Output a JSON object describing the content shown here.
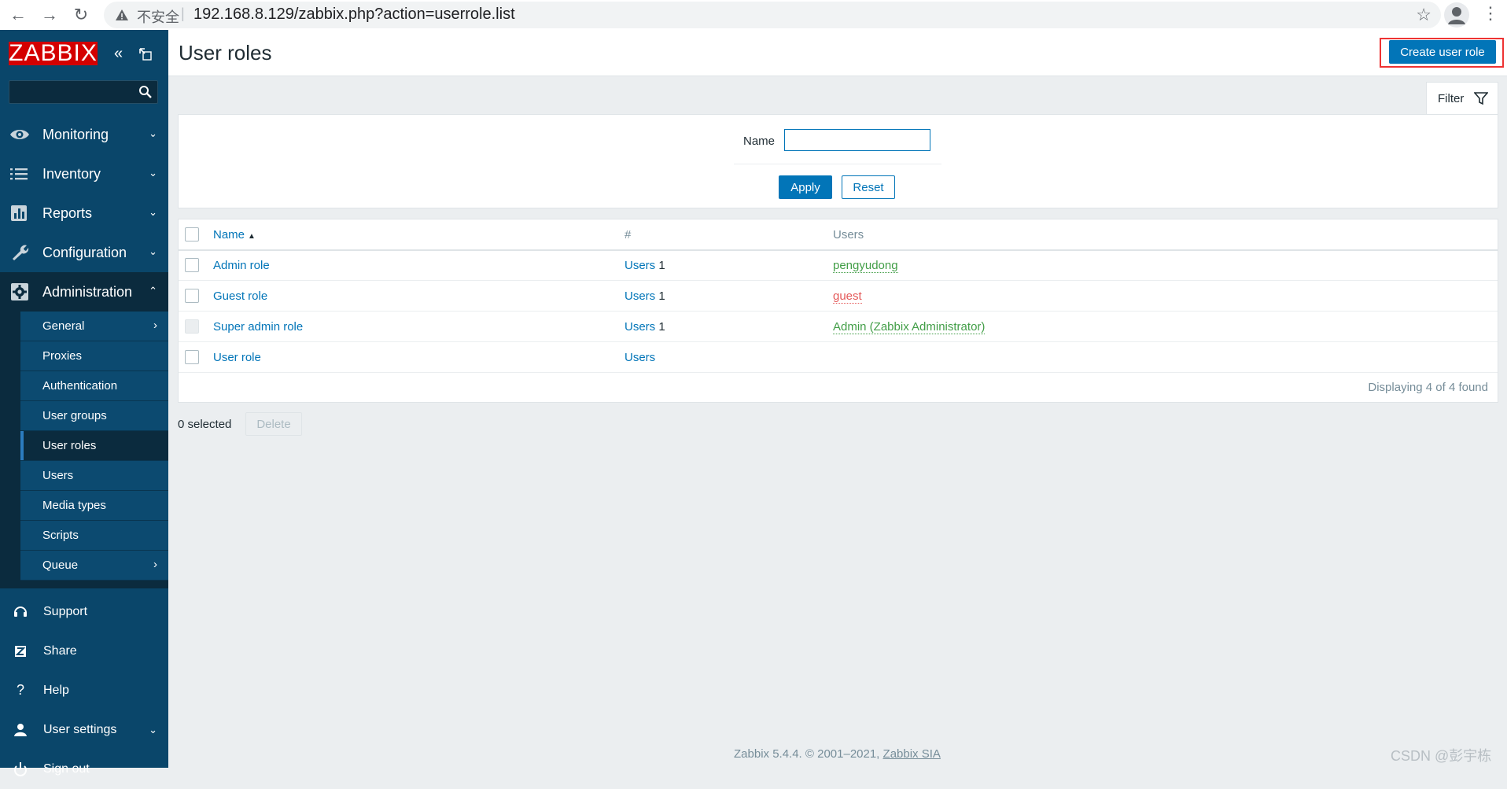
{
  "browser": {
    "insecure_label": "不安全",
    "url": "192.168.8.129/zabbix.php?action=userrole.list"
  },
  "sidebar": {
    "logo": "ZABBIX",
    "search_placeholder": "",
    "menu": [
      {
        "label": "Monitoring",
        "icon": "eye-icon"
      },
      {
        "label": "Inventory",
        "icon": "list-icon"
      },
      {
        "label": "Reports",
        "icon": "bar-chart-icon"
      },
      {
        "label": "Configuration",
        "icon": "wrench-icon"
      },
      {
        "label": "Administration",
        "icon": "gear-icon"
      }
    ],
    "admin_submenu": [
      {
        "label": "General",
        "has_arrow": true
      },
      {
        "label": "Proxies"
      },
      {
        "label": "Authentication"
      },
      {
        "label": "User groups"
      },
      {
        "label": "User roles",
        "active": true
      },
      {
        "label": "Users"
      },
      {
        "label": "Media types"
      },
      {
        "label": "Scripts"
      },
      {
        "label": "Queue",
        "has_arrow": true
      }
    ],
    "footer": [
      {
        "label": "Support",
        "icon": "headset-icon"
      },
      {
        "label": "Share",
        "icon": "share-z-icon"
      },
      {
        "label": "Help",
        "icon": "help-icon"
      },
      {
        "label": "User settings",
        "icon": "user-icon"
      },
      {
        "label": "Sign out",
        "icon": "power-icon"
      }
    ]
  },
  "header": {
    "title": "User roles",
    "create_button": "Create user role"
  },
  "filter": {
    "tab_label": "Filter",
    "name_label": "Name",
    "name_value": "",
    "apply": "Apply",
    "reset": "Reset"
  },
  "table": {
    "columns": {
      "name": "Name",
      "num": "#",
      "users": "Users"
    },
    "rows": [
      {
        "name": "Admin role",
        "users_link": "Users",
        "count": "1",
        "users": "pengyudong",
        "user_status": "green"
      },
      {
        "name": "Guest role",
        "users_link": "Users",
        "count": "1",
        "users": "guest",
        "user_status": "red"
      },
      {
        "name": "Super admin role",
        "users_link": "Users",
        "count": "1",
        "users": "Admin (Zabbix Administrator)",
        "user_status": "green",
        "checkbox_disabled": true
      },
      {
        "name": "User role",
        "users_link": "Users",
        "count": "",
        "users": "",
        "user_status": ""
      }
    ],
    "paging": "Displaying 4 of 4 found"
  },
  "actions": {
    "selected": "0 selected",
    "delete": "Delete"
  },
  "footer": {
    "text": "Zabbix 5.4.4. © 2001–2021,",
    "link": "Zabbix SIA"
  },
  "watermark": "CSDN @彭宇栋"
}
